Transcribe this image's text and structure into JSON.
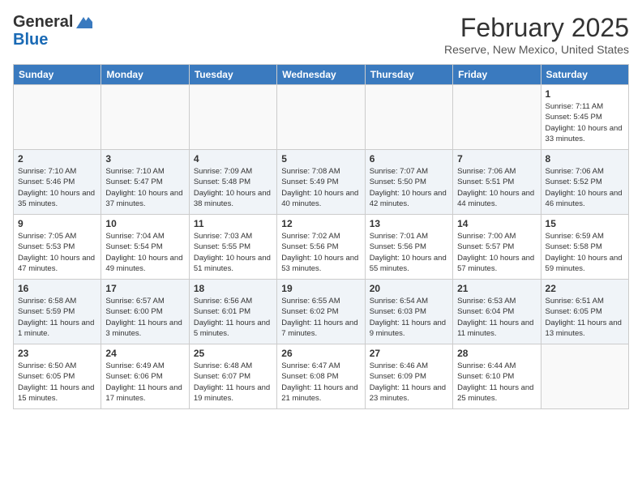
{
  "header": {
    "logo_general": "General",
    "logo_blue": "Blue",
    "month_title": "February 2025",
    "location": "Reserve, New Mexico, United States"
  },
  "days_of_week": [
    "Sunday",
    "Monday",
    "Tuesday",
    "Wednesday",
    "Thursday",
    "Friday",
    "Saturday"
  ],
  "weeks": [
    [
      {
        "day": "",
        "info": ""
      },
      {
        "day": "",
        "info": ""
      },
      {
        "day": "",
        "info": ""
      },
      {
        "day": "",
        "info": ""
      },
      {
        "day": "",
        "info": ""
      },
      {
        "day": "",
        "info": ""
      },
      {
        "day": "1",
        "info": "Sunrise: 7:11 AM\nSunset: 5:45 PM\nDaylight: 10 hours and 33 minutes."
      }
    ],
    [
      {
        "day": "2",
        "info": "Sunrise: 7:10 AM\nSunset: 5:46 PM\nDaylight: 10 hours and 35 minutes."
      },
      {
        "day": "3",
        "info": "Sunrise: 7:10 AM\nSunset: 5:47 PM\nDaylight: 10 hours and 37 minutes."
      },
      {
        "day": "4",
        "info": "Sunrise: 7:09 AM\nSunset: 5:48 PM\nDaylight: 10 hours and 38 minutes."
      },
      {
        "day": "5",
        "info": "Sunrise: 7:08 AM\nSunset: 5:49 PM\nDaylight: 10 hours and 40 minutes."
      },
      {
        "day": "6",
        "info": "Sunrise: 7:07 AM\nSunset: 5:50 PM\nDaylight: 10 hours and 42 minutes."
      },
      {
        "day": "7",
        "info": "Sunrise: 7:06 AM\nSunset: 5:51 PM\nDaylight: 10 hours and 44 minutes."
      },
      {
        "day": "8",
        "info": "Sunrise: 7:06 AM\nSunset: 5:52 PM\nDaylight: 10 hours and 46 minutes."
      }
    ],
    [
      {
        "day": "9",
        "info": "Sunrise: 7:05 AM\nSunset: 5:53 PM\nDaylight: 10 hours and 47 minutes."
      },
      {
        "day": "10",
        "info": "Sunrise: 7:04 AM\nSunset: 5:54 PM\nDaylight: 10 hours and 49 minutes."
      },
      {
        "day": "11",
        "info": "Sunrise: 7:03 AM\nSunset: 5:55 PM\nDaylight: 10 hours and 51 minutes."
      },
      {
        "day": "12",
        "info": "Sunrise: 7:02 AM\nSunset: 5:56 PM\nDaylight: 10 hours and 53 minutes."
      },
      {
        "day": "13",
        "info": "Sunrise: 7:01 AM\nSunset: 5:56 PM\nDaylight: 10 hours and 55 minutes."
      },
      {
        "day": "14",
        "info": "Sunrise: 7:00 AM\nSunset: 5:57 PM\nDaylight: 10 hours and 57 minutes."
      },
      {
        "day": "15",
        "info": "Sunrise: 6:59 AM\nSunset: 5:58 PM\nDaylight: 10 hours and 59 minutes."
      }
    ],
    [
      {
        "day": "16",
        "info": "Sunrise: 6:58 AM\nSunset: 5:59 PM\nDaylight: 11 hours and 1 minute."
      },
      {
        "day": "17",
        "info": "Sunrise: 6:57 AM\nSunset: 6:00 PM\nDaylight: 11 hours and 3 minutes."
      },
      {
        "day": "18",
        "info": "Sunrise: 6:56 AM\nSunset: 6:01 PM\nDaylight: 11 hours and 5 minutes."
      },
      {
        "day": "19",
        "info": "Sunrise: 6:55 AM\nSunset: 6:02 PM\nDaylight: 11 hours and 7 minutes."
      },
      {
        "day": "20",
        "info": "Sunrise: 6:54 AM\nSunset: 6:03 PM\nDaylight: 11 hours and 9 minutes."
      },
      {
        "day": "21",
        "info": "Sunrise: 6:53 AM\nSunset: 6:04 PM\nDaylight: 11 hours and 11 minutes."
      },
      {
        "day": "22",
        "info": "Sunrise: 6:51 AM\nSunset: 6:05 PM\nDaylight: 11 hours and 13 minutes."
      }
    ],
    [
      {
        "day": "23",
        "info": "Sunrise: 6:50 AM\nSunset: 6:05 PM\nDaylight: 11 hours and 15 minutes."
      },
      {
        "day": "24",
        "info": "Sunrise: 6:49 AM\nSunset: 6:06 PM\nDaylight: 11 hours and 17 minutes."
      },
      {
        "day": "25",
        "info": "Sunrise: 6:48 AM\nSunset: 6:07 PM\nDaylight: 11 hours and 19 minutes."
      },
      {
        "day": "26",
        "info": "Sunrise: 6:47 AM\nSunset: 6:08 PM\nDaylight: 11 hours and 21 minutes."
      },
      {
        "day": "27",
        "info": "Sunrise: 6:46 AM\nSunset: 6:09 PM\nDaylight: 11 hours and 23 minutes."
      },
      {
        "day": "28",
        "info": "Sunrise: 6:44 AM\nSunset: 6:10 PM\nDaylight: 11 hours and 25 minutes."
      },
      {
        "day": "",
        "info": ""
      }
    ]
  ]
}
